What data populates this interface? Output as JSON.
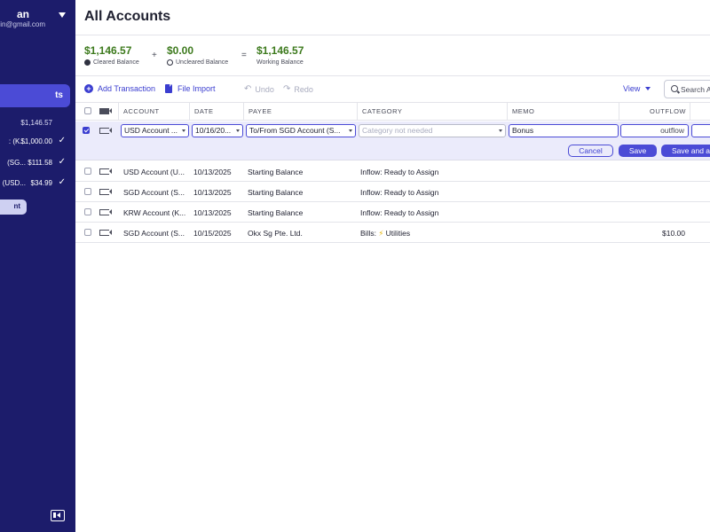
{
  "sidebar": {
    "user_name": "an",
    "user_email": "in@gmail.com",
    "active_item": "ts",
    "total": "$1,146.57",
    "accounts": [
      {
        "name": ": (K...",
        "amount": "$1,000.00"
      },
      {
        "name": "(SG...",
        "amount": "$111.58"
      },
      {
        "name": "(USD...",
        "amount": "$34.99"
      }
    ],
    "add_button": "nt"
  },
  "header": {
    "title": "All Accounts"
  },
  "balances": {
    "cleared": {
      "value": "$1,146.57",
      "label": "Cleared Balance"
    },
    "uncleared": {
      "value": "$0.00",
      "label": "Uncleared Balance"
    },
    "working": {
      "value": "$1,146.57",
      "label": "Working Balance"
    },
    "plus": "+",
    "equals": "="
  },
  "toolbar": {
    "add_transaction": "Add Transaction",
    "file_import": "File Import",
    "undo": "Undo",
    "redo": "Redo",
    "view": "View",
    "search_placeholder": "Search A"
  },
  "table": {
    "columns": [
      "ACCOUNT",
      "DATE",
      "PAYEE",
      "CATEGORY",
      "MEMO",
      "OUTFLOW"
    ],
    "edit_row": {
      "account": "USD Account ...",
      "date": "10/16/20...",
      "payee": "To/From SGD Account (S...",
      "category_placeholder": "Category not needed",
      "memo": "Bonus",
      "outflow_placeholder": "outflow",
      "cancel": "Cancel",
      "save": "Save",
      "save_and_add": "Save and a"
    },
    "rows": [
      {
        "account": "USD Account (U...",
        "date": "10/13/2025",
        "payee": "Starting Balance",
        "category": "Inflow: Ready to Assign",
        "outflow": ""
      },
      {
        "account": "SGD Account (S...",
        "date": "10/13/2025",
        "payee": "Starting Balance",
        "category": "Inflow: Ready to Assign",
        "outflow": ""
      },
      {
        "account": "KRW Account (K...",
        "date": "10/13/2025",
        "payee": "Starting Balance",
        "category": "Inflow: Ready to Assign",
        "outflow": ""
      },
      {
        "account": "SGD Account (S...",
        "date": "10/15/2025",
        "payee": "Okx Sg Pte. Ltd.",
        "category_prefix": "Bills:",
        "category_emoji": "⚡",
        "category_suffix": "Utilities",
        "outflow": "$10.00"
      }
    ]
  }
}
